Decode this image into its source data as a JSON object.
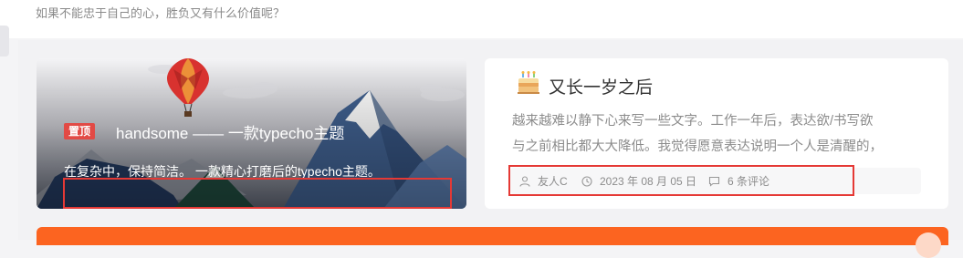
{
  "site": {
    "tagline": "如果不能忠于自己的心，胜负又有什么价值呢？"
  },
  "featured": {
    "badge": "置顶",
    "title": "handsome —— 一款typecho主题",
    "description": "在复杂中，保持简洁。 一款精心打磨后的typecho主题。"
  },
  "post": {
    "icon": "cake-icon",
    "title": "又长一岁之后",
    "excerpt_lines": [
      "越来越难以静下心来写一些文字。工作一年后，表达欲/书写欲",
      "与之前相比都大大降低。我觉得愿意表达说明一个人是清醒的，"
    ],
    "author": "友人C",
    "date": "2023 年 08 月 05 日",
    "comments": "6 条评论"
  },
  "colors": {
    "badge": "#e24a45",
    "highlight_box": "#e53935",
    "accent_bar": "#fc6420"
  }
}
